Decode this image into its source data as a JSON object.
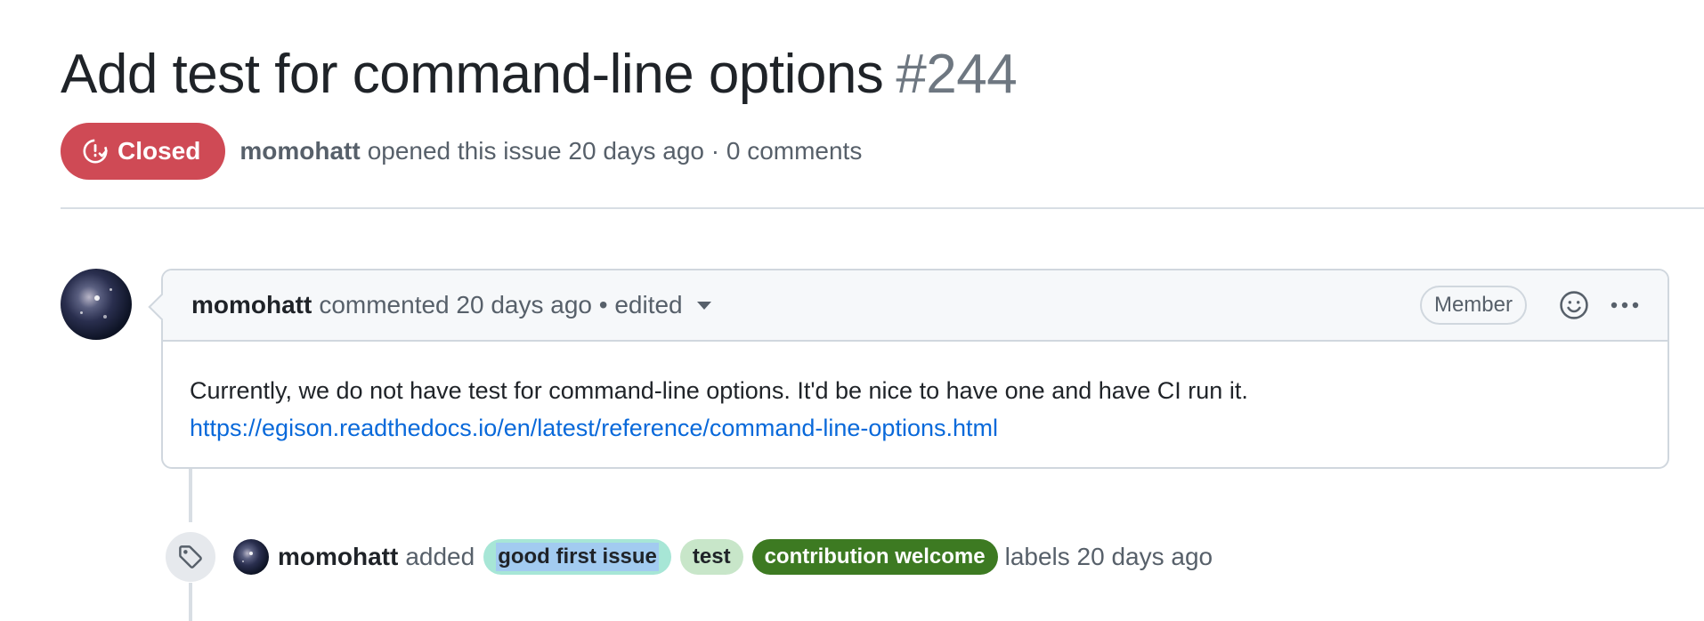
{
  "issue": {
    "title": "Add test for command-line options",
    "number": "#244",
    "state": "Closed",
    "author": "momohatt",
    "opened_text": "opened this issue 20 days ago · 0 comments"
  },
  "comment": {
    "author": "momohatt",
    "meta": "commented 20 days ago • edited",
    "role": "Member",
    "body_line1": "Currently, we do not have test for command-line options. It'd be nice to have one and have CI run it.",
    "link": "https://egison.readthedocs.io/en/latest/reference/command-line-options.html"
  },
  "event": {
    "actor": "momohatt",
    "action": "added",
    "labels": [
      {
        "name": "good first issue",
        "color": "#a7e6d6"
      },
      {
        "name": "test",
        "color": "#c8e6c9"
      },
      {
        "name": "contribution welcome",
        "color": "#3d7a22"
      }
    ],
    "tail": "labels 20 days ago"
  },
  "colors": {
    "closed": "#cf4a55",
    "link": "#0969da"
  },
  "icons": {
    "state": "issue-closed-icon",
    "reaction": "smiley-icon",
    "more": "kebab-icon",
    "event": "tag-icon"
  }
}
